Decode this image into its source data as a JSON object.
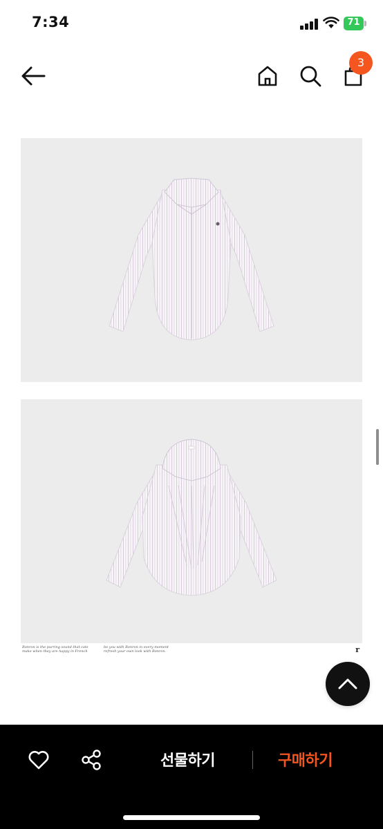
{
  "status_bar": {
    "time": "7:34",
    "battery": "71"
  },
  "header": {
    "cart_count": "3",
    "icons": [
      "back-arrow-icon",
      "home-icon",
      "search-icon",
      "shopping-bag-icon"
    ]
  },
  "images": [
    {
      "name": "front",
      "description_icon": "shirt-front-image"
    },
    {
      "name": "back",
      "description_icon": "shirt-back-image"
    }
  ],
  "caption": {
    "left": "Ronron is the purring sound that cats make when they are happy in French",
    "middle": "be you with Ronron in every moment refresh your own look with Ronron.",
    "logo": "r"
  },
  "bottom_bar": {
    "gift_label": "선물하기",
    "buy_label": "구매하기",
    "accent_color": "#f5561f"
  }
}
